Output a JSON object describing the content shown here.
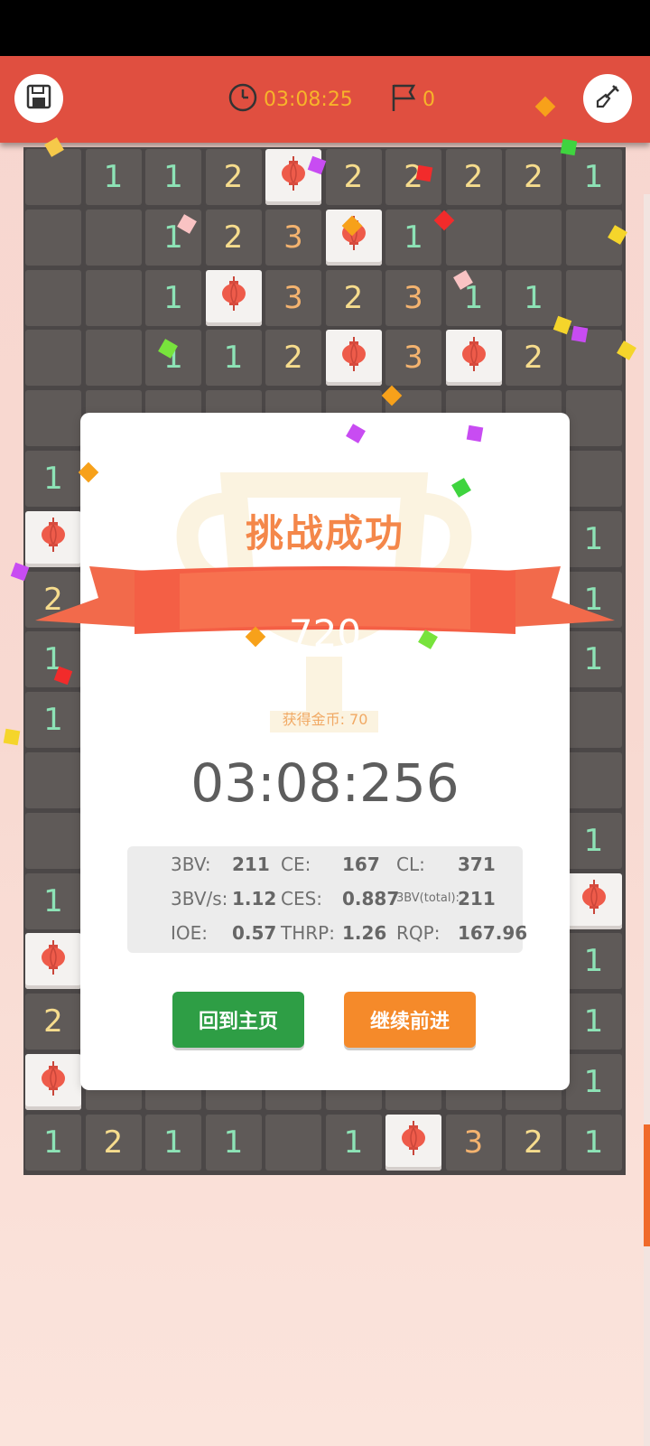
{
  "header": {
    "timer": "03:08:25",
    "flag_count": "0",
    "save_icon": "save-icon",
    "clock_icon": "clock-icon",
    "flag_icon": "flag-icon",
    "shovel_icon": "shovel-icon"
  },
  "board": {
    "rows": [
      [
        "",
        "1",
        "1",
        "2",
        "L",
        "2",
        "2",
        "2",
        "2",
        "1"
      ],
      [
        "",
        "",
        "1",
        "2",
        "3",
        "L",
        "1",
        "",
        "",
        ""
      ],
      [
        "",
        "",
        "1",
        "L",
        "3",
        "2",
        "3",
        "1",
        "1",
        ""
      ],
      [
        "",
        "",
        "1",
        "1",
        "2",
        "L",
        "3",
        "L",
        "2",
        ""
      ],
      [
        "",
        "",
        "",
        "",
        "",
        "",
        "",
        "",
        "",
        ""
      ],
      [
        "1",
        "",
        "",
        "",
        "",
        "",
        "",
        "",
        "",
        ""
      ],
      [
        "L",
        "",
        "",
        "",
        "",
        "",
        "",
        "",
        "",
        "1"
      ],
      [
        "2",
        "",
        "",
        "",
        "",
        "",
        "",
        "",
        "",
        "1"
      ],
      [
        "1",
        "",
        "",
        "",
        "",
        "",
        "",
        "",
        "",
        "1"
      ],
      [
        "1",
        "",
        "",
        "",
        "",
        "",
        "",
        "",
        "",
        ""
      ],
      [
        "",
        "",
        "",
        "",
        "",
        "",
        "",
        "",
        "",
        ""
      ],
      [
        "",
        "",
        "",
        "",
        "",
        "",
        "",
        "",
        "",
        "1"
      ],
      [
        "1",
        "",
        "",
        "",
        "",
        "",
        "",
        "",
        "",
        "L"
      ],
      [
        "L",
        "",
        "",
        "",
        "",
        "",
        "",
        "",
        "",
        "1"
      ],
      [
        "2",
        "",
        "",
        "",
        "",
        "",
        "",
        "",
        "",
        "1"
      ],
      [
        "L",
        "",
        "",
        "",
        "",
        "",
        "",
        "",
        "",
        "1"
      ],
      [
        "1",
        "2",
        "1",
        "1",
        "",
        "1",
        "L",
        "3",
        "2",
        "1"
      ]
    ]
  },
  "dialog": {
    "title": "挑战成功",
    "score": "720",
    "coins_label": "获得金币: 70",
    "final_time": "03:08:256",
    "stats": [
      {
        "label": "3BV:",
        "value": "211"
      },
      {
        "label": "CE:",
        "value": "167"
      },
      {
        "label": "CL:",
        "value": "371"
      },
      {
        "label": "3BV/s:",
        "value": "1.12"
      },
      {
        "label": "CES:",
        "value": "0.887"
      },
      {
        "label": "3BV(total):",
        "value": "211"
      },
      {
        "label": "IOE:",
        "value": "0.57"
      },
      {
        "label": "THRP:",
        "value": "1.26"
      },
      {
        "label": "RQP:",
        "value": "167.96"
      }
    ],
    "home_button": "回到主页",
    "continue_button": "继续前进"
  },
  "colors": {
    "header_bg": "#e04f40",
    "accent_orange": "#f4874a",
    "home_green": "#2e9e45",
    "continue_orange": "#f58a2a",
    "timer_yellow": "#f7b42a"
  }
}
